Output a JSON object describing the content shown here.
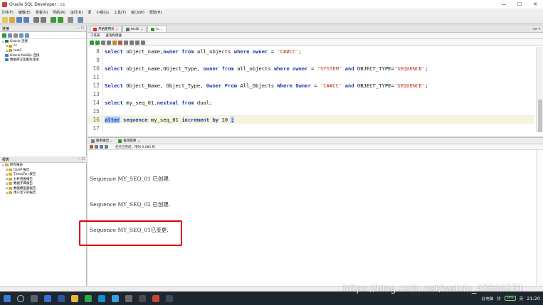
{
  "window": {
    "title": "Oracle SQL Developer : cc",
    "controls": [
      "—",
      "☐",
      "✕"
    ]
  },
  "menu": [
    "文件(F)",
    "编辑(E)",
    "查看(V)",
    "导航(N)",
    "运行(R)",
    "源",
    "小组(G)",
    "工具(T)",
    "窗口(W)",
    "帮助(H)"
  ],
  "left_panel": {
    "connections_title": "连接",
    "controls": "− ☐",
    "tree": [
      {
        "label": "Oracle 连接",
        "indent": false,
        "expander": "⊟",
        "color": "#2f7d32"
      },
      {
        "label": "cc",
        "indent": true,
        "expander": "⊞",
        "color": "#c8a020"
      },
      {
        "label": "test1",
        "indent": true,
        "expander": "⊞",
        "color": "#c8a020"
      },
      {
        "label": "Oracle NoSQL 连接",
        "indent": false,
        "expander": "",
        "color": "#4a7abf"
      },
      {
        "label": "数据库方案服务连接",
        "indent": false,
        "expander": "",
        "color": "#4a7abf"
      }
    ],
    "reports_title": "报表",
    "reports": [
      {
        "label": "所有报表",
        "indent": false,
        "expander": "⊟",
        "color": "#d8a830"
      },
      {
        "label": "OLAP 报告",
        "indent": true,
        "expander": "⊞",
        "color": "#d8a830"
      },
      {
        "label": "TimesTen 报告",
        "indent": true,
        "expander": "⊞",
        "color": "#d8a830"
      },
      {
        "label": "分析视图报告",
        "indent": true,
        "expander": "⊞",
        "color": "#d8a830"
      },
      {
        "label": "数据字典报告",
        "indent": true,
        "expander": "⊞",
        "color": "#d8a830"
      },
      {
        "label": "数据模型器报告",
        "indent": true,
        "expander": "⊞",
        "color": "#d8a830"
      },
      {
        "label": "用户定义的报告",
        "indent": true,
        "expander": "⊞",
        "color": "#d8a830"
      }
    ]
  },
  "doc_tabs": [
    {
      "label": "开始使用页",
      "active": false,
      "color": "#d03a2a"
    },
    {
      "label": "test1",
      "active": false,
      "color": "#3c8a3c"
    },
    {
      "label": "cc",
      "active": true,
      "color": "#3c8a3c"
    }
  ],
  "doc_tabs_right": "◂ ▸ ▾",
  "editor_subtabs": [
    "工作表",
    "查询构建器"
  ],
  "code_lines": [
    {
      "num": "8",
      "parts": [
        [
          "kw",
          "select"
        ],
        [
          "fn",
          " object_name,"
        ],
        [
          "kw",
          "owner"
        ],
        [
          "kw",
          " from"
        ],
        [
          "fn",
          " all_objects "
        ],
        [
          "kw",
          "where"
        ],
        [
          "kw",
          " owner"
        ],
        [
          "fn",
          " = "
        ],
        [
          "str",
          "'C##CC'"
        ],
        [
          "fn",
          ";"
        ]
      ]
    },
    {
      "num": "9",
      "parts": []
    },
    {
      "num": "10",
      "parts": [
        [
          "kw",
          "select"
        ],
        [
          "fn",
          " object_name,Object_Type, "
        ],
        [
          "kw",
          "owner"
        ],
        [
          "kw",
          " from"
        ],
        [
          "fn",
          " all_objects "
        ],
        [
          "kw",
          "where"
        ],
        [
          "kw",
          " owner"
        ],
        [
          "fn",
          " = "
        ],
        [
          "str",
          "'SYSTEM'"
        ],
        [
          "kw",
          " and"
        ],
        [
          "fn",
          " OBJECT_TYPE="
        ],
        [
          "str",
          "'SEQUENCE'"
        ],
        [
          "fn",
          ";"
        ]
      ]
    },
    {
      "num": "11",
      "parts": []
    },
    {
      "num": "12",
      "parts": [
        [
          "kw",
          "Select"
        ],
        [
          "fn",
          " Object_Name, Object_Type, "
        ],
        [
          "kw",
          "Owner"
        ],
        [
          "kw",
          " From"
        ],
        [
          "fn",
          " All_Objects "
        ],
        [
          "kw",
          "Where"
        ],
        [
          "kw",
          " Owner"
        ],
        [
          "fn",
          " = "
        ],
        [
          "str",
          "'C##CC'"
        ],
        [
          "kw",
          " and"
        ],
        [
          "fn",
          " OBJECT_TYPE="
        ],
        [
          "str",
          "'SEQUENCE'"
        ],
        [
          "fn",
          ";"
        ]
      ]
    },
    {
      "num": "13",
      "parts": []
    },
    {
      "num": "14",
      "parts": [
        [
          "kw",
          "select"
        ],
        [
          "fn",
          " my_seq_01."
        ],
        [
          "kw",
          "nextval"
        ],
        [
          "kw",
          " from"
        ],
        [
          "fn",
          " dual;"
        ]
      ]
    },
    {
      "num": "15",
      "parts": []
    },
    {
      "num": "16",
      "parts": [
        [
          "kwhl",
          "alter"
        ],
        [
          "kw",
          " sequence"
        ],
        [
          "fn",
          " my_seq_01 "
        ],
        [
          "kw",
          "increment"
        ],
        [
          "kw",
          " by"
        ],
        [
          "fn",
          " 10 "
        ],
        [
          "hl",
          ";"
        ]
      ]
    },
    {
      "num": "17",
      "parts": []
    }
  ],
  "output": {
    "tabs": [
      {
        "label": "脚本输出",
        "close": "×"
      },
      {
        "label": "查询结果",
        "close": "×"
      }
    ],
    "status": "任务已完成，用时 0.081 秒",
    "lines": [
      "Sequence MY_SEQ_01 已创建.",
      "Sequence MY_SEQ_02 已创建.",
      "Sequence MY_SEQ_01已变更."
    ]
  },
  "taskbar": {
    "ime": "拼",
    "lang": "英",
    "battery": "59%",
    "clock": "21:20",
    "network": "此电脑"
  },
  "watermark": "https://blog.csdn.net/weixin_43644231"
}
